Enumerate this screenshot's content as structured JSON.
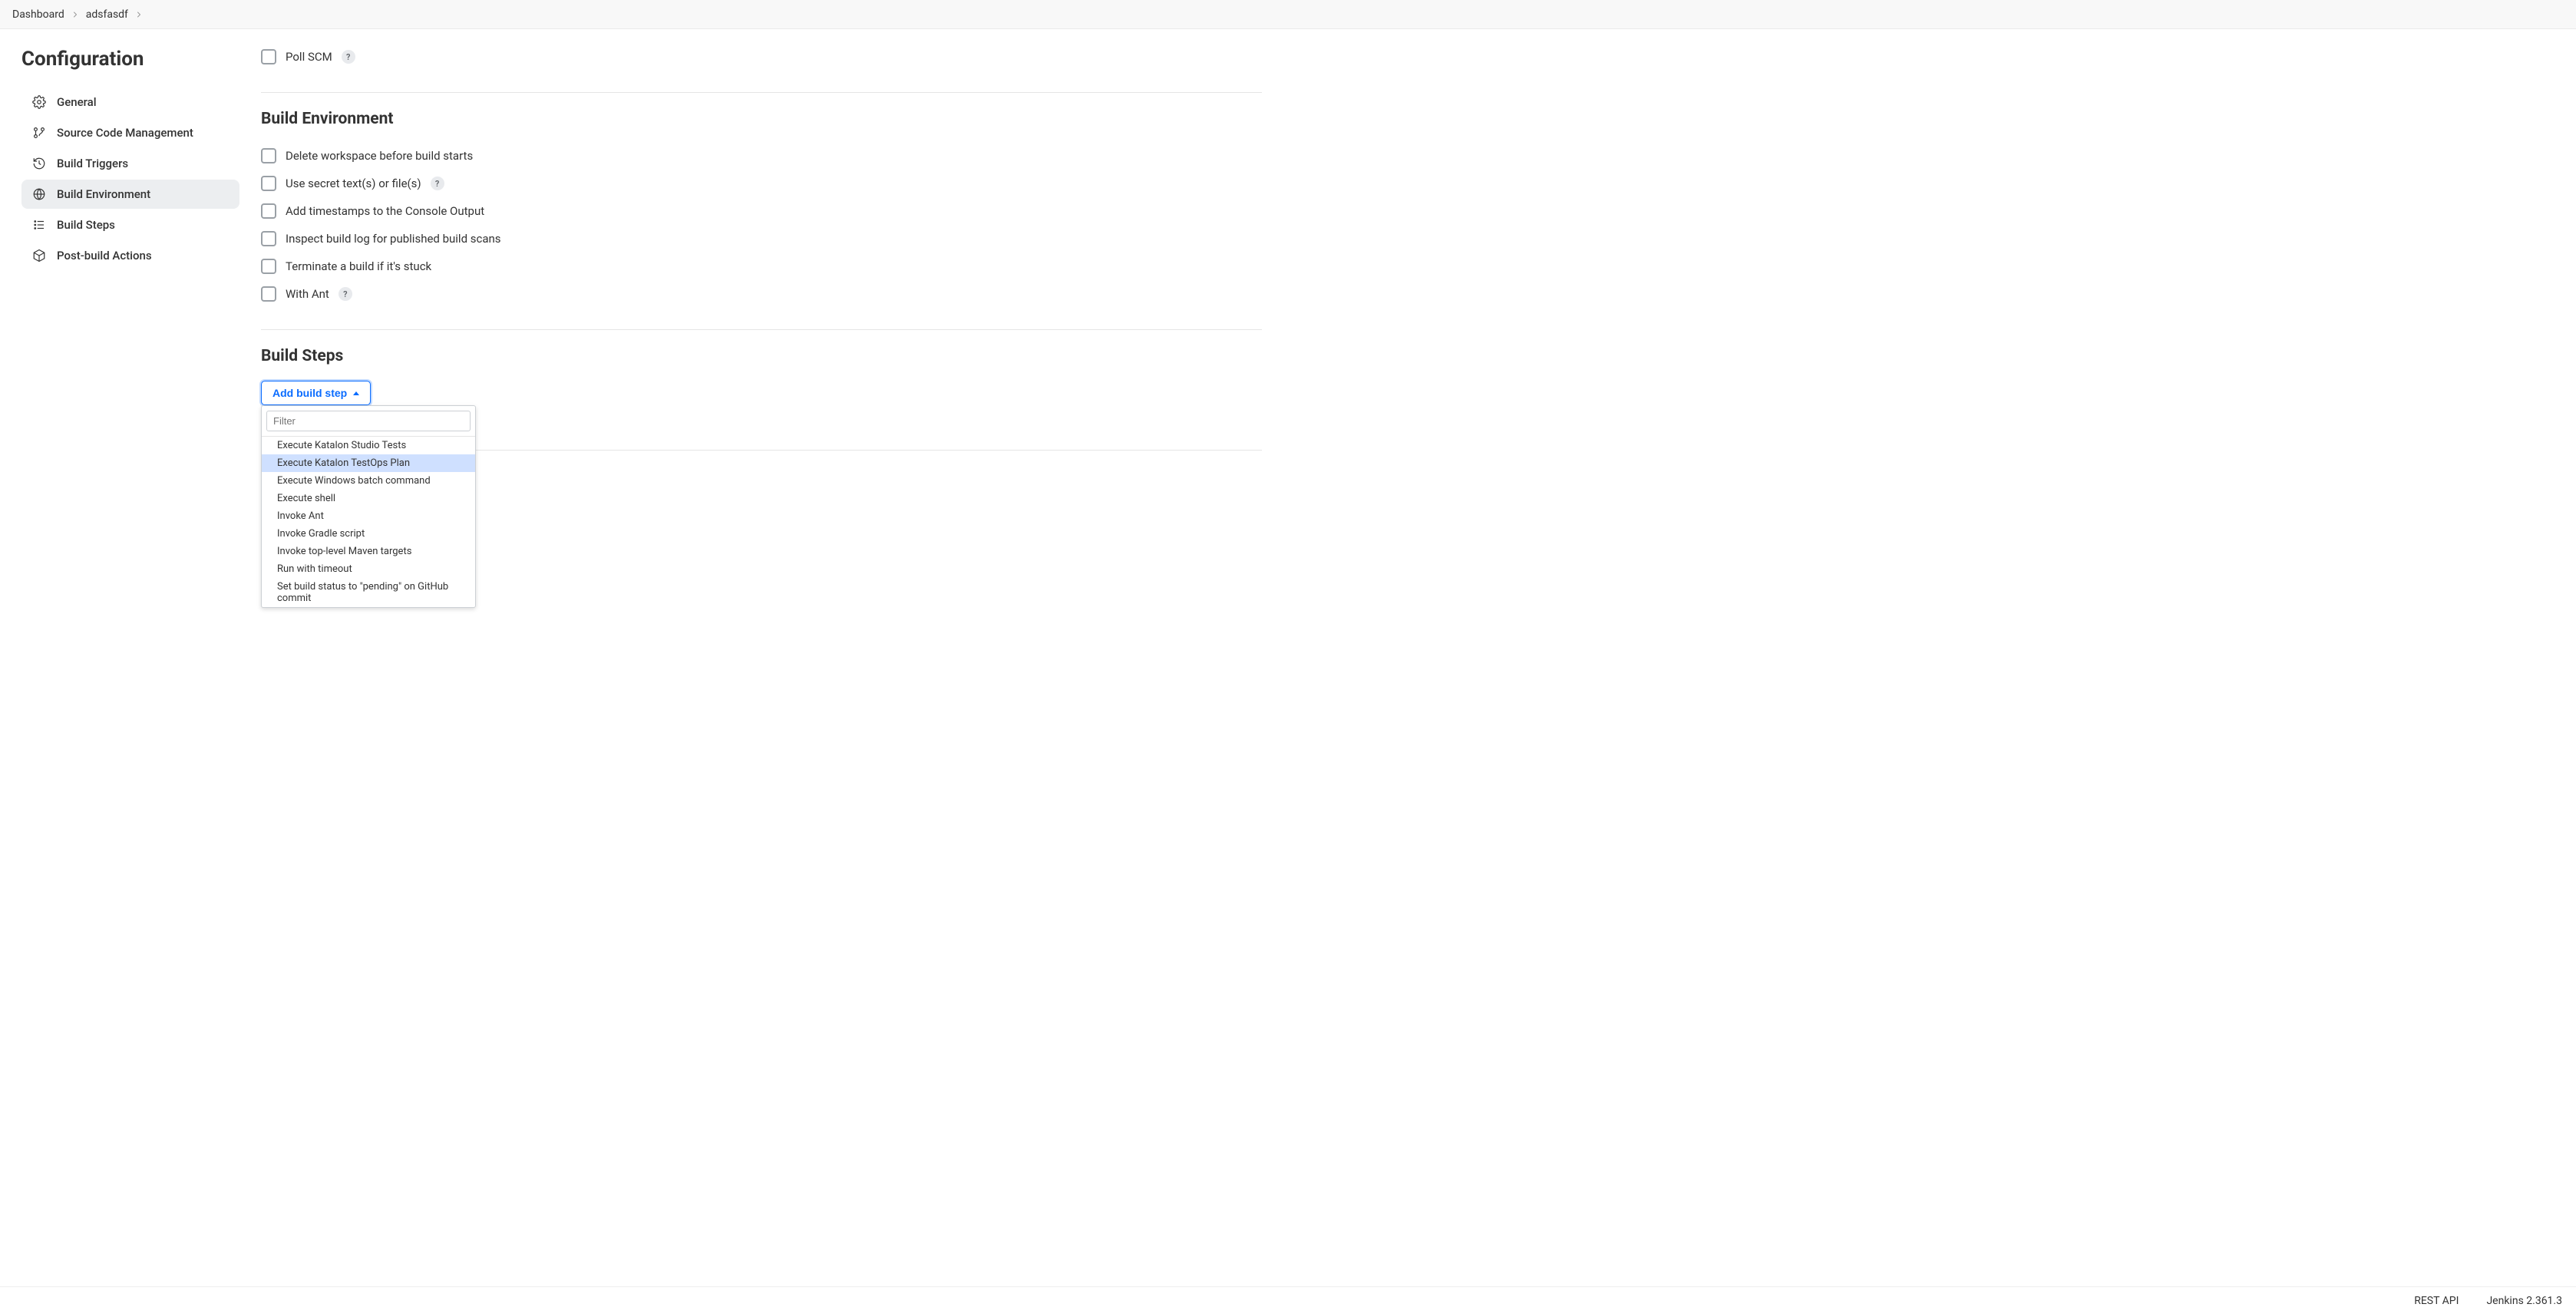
{
  "breadcrumbs": [
    {
      "label": "Dashboard"
    },
    {
      "label": "adsfasdf"
    }
  ],
  "page_title": "Configuration",
  "sidebar": {
    "items": [
      {
        "label": "General"
      },
      {
        "label": "Source Code Management"
      },
      {
        "label": "Build Triggers"
      },
      {
        "label": "Build Environment"
      },
      {
        "label": "Build Steps"
      },
      {
        "label": "Post-build Actions"
      }
    ],
    "active_index": 3
  },
  "triggers": {
    "poll_scm_label": "Poll SCM",
    "help": "?"
  },
  "build_env": {
    "heading": "Build Environment",
    "items": [
      {
        "label": "Delete workspace before build starts",
        "help": false
      },
      {
        "label": "Use secret text(s) or file(s)",
        "help": true
      },
      {
        "label": "Add timestamps to the Console Output",
        "help": false
      },
      {
        "label": "Inspect build log for published build scans",
        "help": false
      },
      {
        "label": "Terminate a build if it's stuck",
        "help": false
      },
      {
        "label": "With Ant",
        "help": true
      }
    ],
    "help": "?"
  },
  "build_steps": {
    "heading": "Build Steps",
    "button_label": "Add build step",
    "filter_placeholder": "Filter",
    "options": [
      "Execute Katalon Studio Tests",
      "Execute Katalon TestOps Plan",
      "Execute Windows batch command",
      "Execute shell",
      "Invoke Ant",
      "Invoke Gradle script",
      "Invoke top-level Maven targets",
      "Run with timeout",
      "Set build status to \"pending\" on GitHub commit"
    ],
    "highlighted_index": 1
  },
  "footer": {
    "rest_api": "REST API",
    "version": "Jenkins 2.361.3"
  }
}
